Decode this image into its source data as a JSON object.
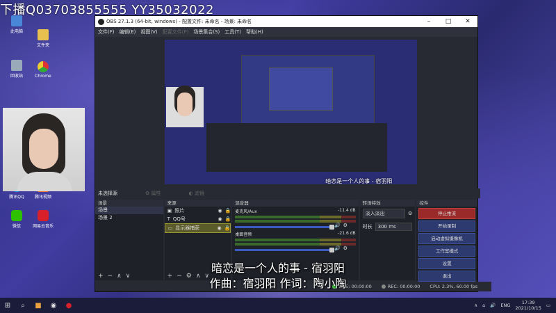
{
  "overlay": {
    "top_text": "下播Q03703855555 YY35032022",
    "sub_line1": "暗恋是一个人的事 - 宿羽阳",
    "sub_line2": "作曲：宿羽阳 作词：陶小陶"
  },
  "desktop_icons": [
    {
      "label": "此电脑"
    },
    {
      "label": "文件夹"
    },
    {
      "label": "回收站"
    },
    {
      "label": "Chrome"
    },
    {
      "label": "腾讯QQ"
    },
    {
      "label": "腾讯视频"
    },
    {
      "label": "微信"
    },
    {
      "label": "网易云音乐"
    }
  ],
  "obs": {
    "title": "OBS 27.1.3 (64-bit, windows) - 配置文件: 未命名 - 场景: 未命名",
    "menu": [
      "文件(F)",
      "编辑(E)",
      "视图(V)",
      "配置文件(P)",
      "场景集合(S)",
      "工具(T)",
      "帮助(H)"
    ],
    "scene_label": "未选择源",
    "props_label": "属性",
    "filters_label": "滤镜",
    "docks": {
      "scenes": {
        "title": "场景",
        "items": [
          "场景",
          "场景 2"
        ]
      },
      "sources": {
        "title": "来源",
        "items": [
          {
            "name": "照片"
          },
          {
            "name": "QQ号"
          },
          {
            "name": "显示器捕获"
          }
        ]
      },
      "mixer": {
        "title": "混音器",
        "channels": [
          {
            "name": "麦克风/Aux",
            "db": "-11.4 dB"
          },
          {
            "name": "桌面音频",
            "db": "-21.6 dB"
          }
        ]
      },
      "transitions": {
        "title": "转场特效",
        "type": "淡入淡出",
        "duration_label": "时长",
        "duration": "300 ms"
      },
      "controls": {
        "title": "控件",
        "buttons": [
          "停止推流",
          "开始录制",
          "启动虚拟摄像机",
          "工作室模式",
          "设置",
          "退出"
        ]
      }
    },
    "status": {
      "live": "LIVE: 00:00:00",
      "rec": "REC: 00:00:00",
      "cpu": "CPU: 2.3%, 60.00 fps"
    }
  },
  "taskbar": {
    "lang": "ENG",
    "time": "17:39",
    "date": "2021/10/15"
  },
  "colors": {
    "stop_stream": "#9a2a2a",
    "desktop": "#2b2d7a"
  }
}
